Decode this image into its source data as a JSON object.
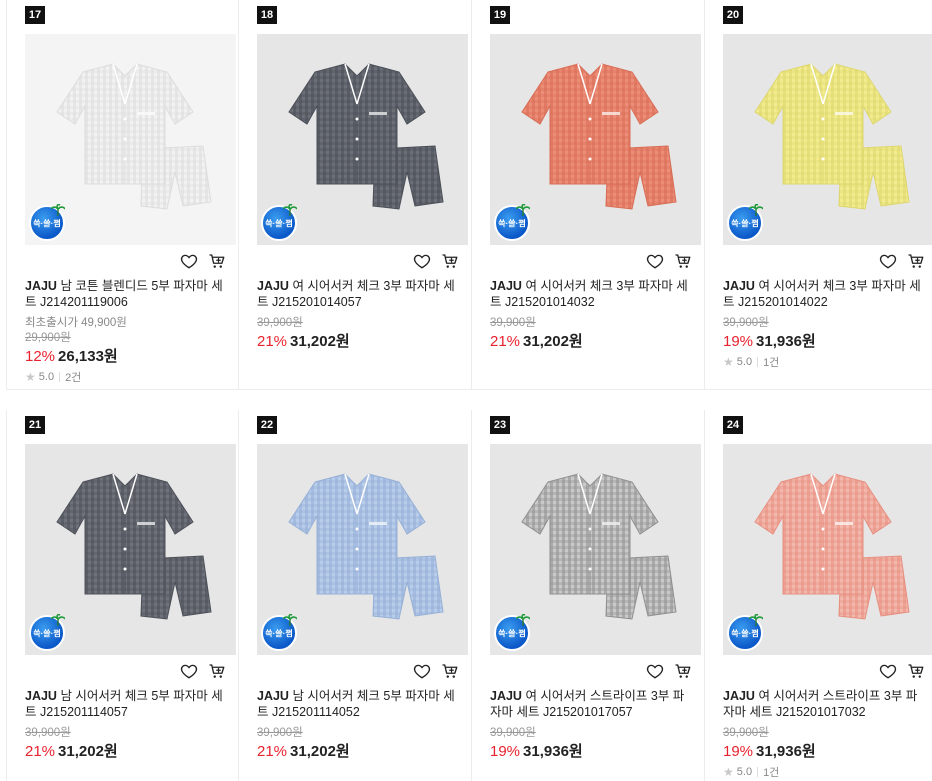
{
  "products": [
    {
      "rank": "17",
      "brand": "JAJU",
      "name": "남 코튼 블렌디드 5부 파자마 세트 J214201119006",
      "release_label": "최초출시가 49,900원",
      "original_price": "29,900원",
      "discount": "12%",
      "price": "26,133원",
      "rating": "5.0",
      "reviews": "2건",
      "color": "#f2f2f2",
      "stripe": "#dcdcdc",
      "bg": "#f4f4f4",
      "badge": "쓱·쓸·쩜"
    },
    {
      "rank": "18",
      "brand": "JAJU",
      "name": "여 시어서커 체크 3부 파자마 세트 J215201014057",
      "release_label": "",
      "original_price": "39,900원",
      "discount": "21%",
      "price": "31,202원",
      "rating": "",
      "reviews": "",
      "color": "#6b6f78",
      "stripe": "#4a4e57",
      "bg": "#e6e6e6",
      "badge": "쓱·쓸·쩜"
    },
    {
      "rank": "19",
      "brand": "JAJU",
      "name": "여 시어서커 체크 3부 파자마 세트 J215201014032",
      "release_label": "",
      "original_price": "39,900원",
      "discount": "21%",
      "price": "31,202원",
      "rating": "",
      "reviews": "",
      "color": "#ec8e77",
      "stripe": "#d86c55",
      "bg": "#e6e6e6",
      "badge": "쓱·쓸·쩜"
    },
    {
      "rank": "20",
      "brand": "JAJU",
      "name": "여 시어서커 체크 3부 파자마 세트 J215201014022",
      "release_label": "",
      "original_price": "39,900원",
      "discount": "19%",
      "price": "31,936원",
      "rating": "5.0",
      "reviews": "1건",
      "color": "#f2ec8e",
      "stripe": "#ddd66e",
      "bg": "#e6e6e6",
      "badge": "쓱·쓸·쩜"
    },
    {
      "rank": "21",
      "brand": "JAJU",
      "name": "남 시어서커 체크 5부 파자마 세트 J215201114057",
      "release_label": "",
      "original_price": "39,900원",
      "discount": "21%",
      "price": "31,202원",
      "rating": "",
      "reviews": "",
      "color": "#6e727a",
      "stripe": "#4c5058",
      "bg": "#e6e6e6",
      "badge": "쓱·쓸·쩜"
    },
    {
      "rank": "22",
      "brand": "JAJU",
      "name": "남 시어서커 체크 5부 파자마 세트 J215201114052",
      "release_label": "",
      "original_price": "39,900원",
      "discount": "21%",
      "price": "31,202원",
      "rating": "",
      "reviews": "",
      "color": "#b8cdea",
      "stripe": "#95afd6",
      "bg": "#e6e6e6",
      "badge": "쓱·쓸·쩜"
    },
    {
      "rank": "23",
      "brand": "JAJU",
      "name": "여 시어서커 스트라이프 3부 파자마 세트 J215201017057",
      "release_label": "",
      "original_price": "39,900원",
      "discount": "19%",
      "price": "31,936원",
      "rating": "",
      "reviews": "",
      "color": "#c9c9c9",
      "stripe": "#8f8f8f",
      "bg": "#e6e6e6",
      "badge": "쓱·쓸·쩜"
    },
    {
      "rank": "24",
      "brand": "JAJU",
      "name": "여 시어서커 스트라이프 3부 파자마 세트 J215201017032",
      "release_label": "",
      "original_price": "39,900원",
      "discount": "19%",
      "price": "31,936원",
      "rating": "5.0",
      "reviews": "1건",
      "color": "#f3b8ad",
      "stripe": "#e68f80",
      "bg": "#e6e6e6",
      "badge": "쓱·쓸·쩜"
    }
  ],
  "icons": {
    "wishlist": "heart-icon",
    "cart": "cart-icon",
    "rating": "star-icon"
  }
}
